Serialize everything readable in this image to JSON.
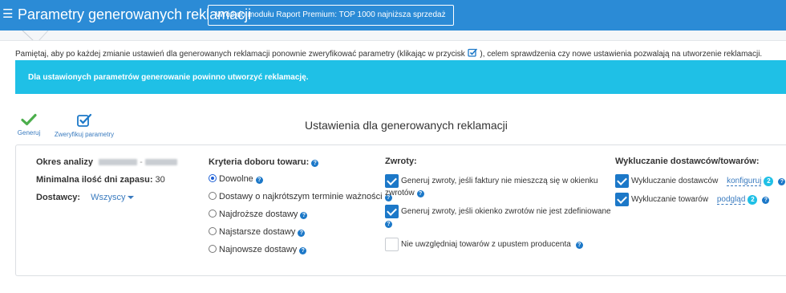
{
  "header": {
    "menu_icon": "hamburger-icon",
    "title": "Parametry generowanych reklamacji",
    "back_button": "Wróć do modułu Raport Premium: TOP 1000 najniższa sprzedaż",
    "bg_color": "#2b8bd6"
  },
  "notice": {
    "before": "Pamiętaj, aby po każdej zmianie ustawień dla generowanych reklamacji ponownie zweryfikować parametry (klikając w przycisk",
    "icon": "check-square-icon",
    "after": "), celem sprawdzenia czy nowe ustawienia pozwalają na utworzenie reklamacji."
  },
  "info": {
    "text": "Dla ustawionych parametrów generowanie powinno utworzyć reklamację.",
    "bg_color": "#1fc0e6"
  },
  "toolbar": {
    "generate_label": "Generuj",
    "generate_icon": "checkmark-icon",
    "verify_label": "Zweryfikuj parametry",
    "verify_icon": "check-square-icon"
  },
  "settings": {
    "title": "Ustawienia dla generowanych reklamacji",
    "analysis_label": "Okres analizy",
    "min_days_label": "Minimalna ilość dni zapasu",
    "min_days_value": "30",
    "suppliers_label": "Dostawcy:",
    "suppliers_value": "Wszyscy",
    "criteria": {
      "label": "Kryteria doboru towaru:",
      "options": [
        {
          "label": "Dowolne",
          "selected": true
        },
        {
          "label": "Dostawy o najkrótszym terminie ważności",
          "selected": false
        },
        {
          "label": "Najdroższe dostawy",
          "selected": false
        },
        {
          "label": "Najstarsze dostawy",
          "selected": false
        },
        {
          "label": "Najnowsze dostawy",
          "selected": false
        }
      ]
    },
    "returns": {
      "label": "Zwroty:",
      "opt1_line1": "Generuj zwroty, jeśli faktury nie mieszczą się w okienku",
      "opt1_line2": "zwrotów",
      "opt1_checked": true,
      "opt2": "Generuj zwroty, jeśli okienko zwrotów nie jest zdefiniowane",
      "opt2_checked": true,
      "opt3": "Nie uwzględniaj towarów z upustem producenta",
      "opt3_checked": false
    },
    "exclusions": {
      "label": "Wykluczanie dostawców/towarów:",
      "suppliers_label": "Wykluczanie dostawców",
      "suppliers_link": "konfiguruj",
      "suppliers_count": "2",
      "products_label": "Wykluczanie towarów",
      "products_link": "podgląd",
      "products_count": "2"
    }
  }
}
